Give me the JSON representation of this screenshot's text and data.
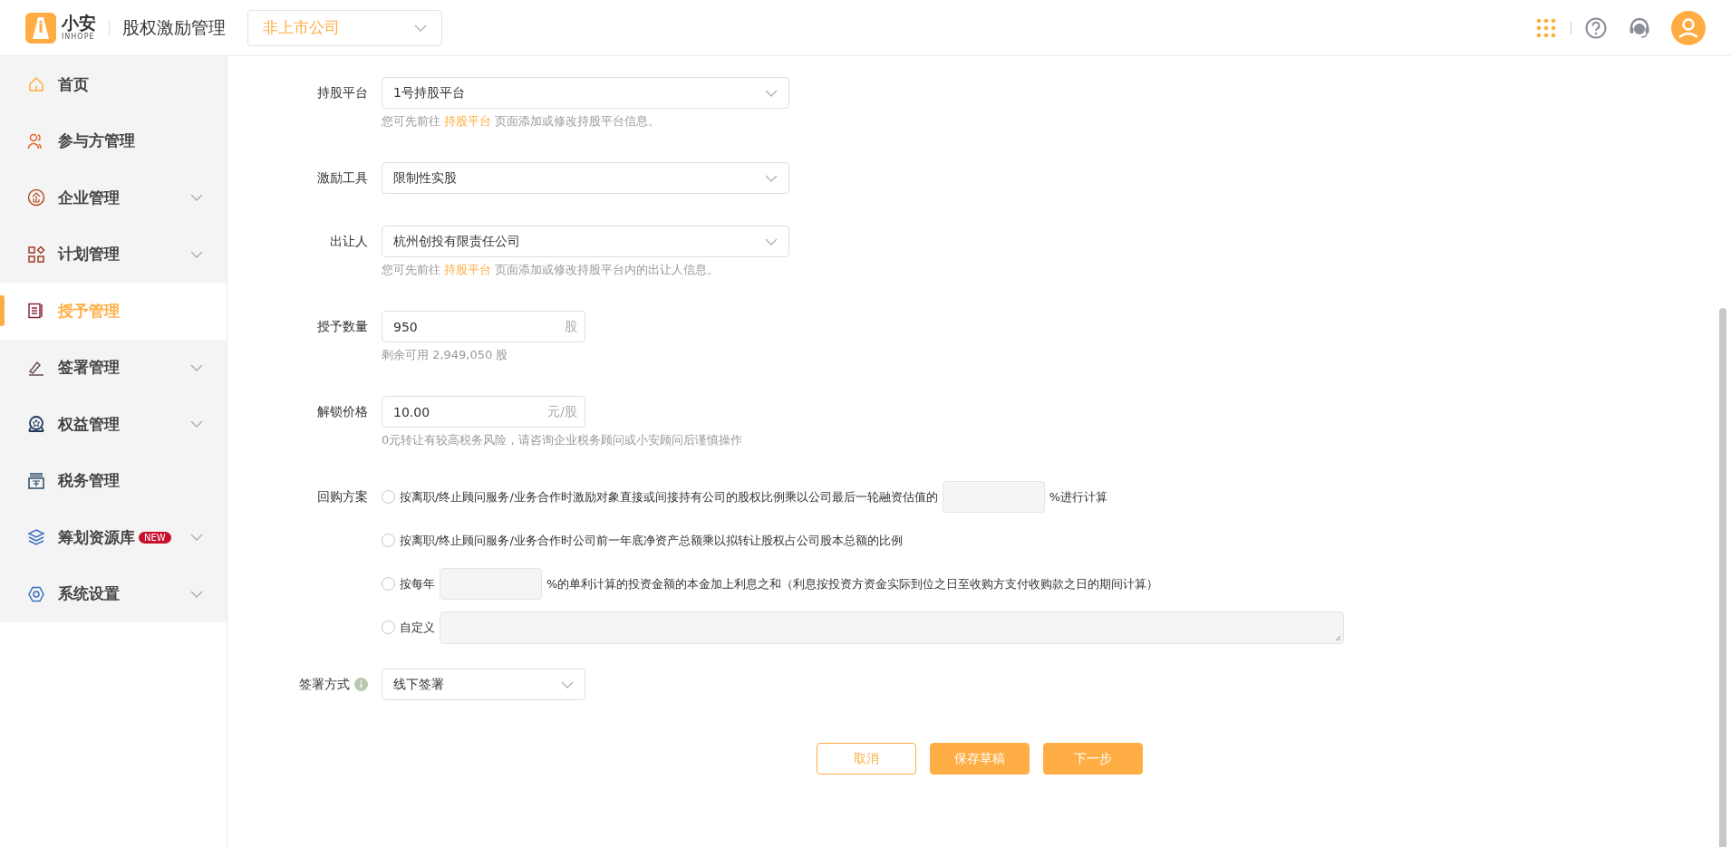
{
  "header": {
    "logo_text": "小安",
    "logo_sub": "INHOPE",
    "app_title": "股权激励管理",
    "company_select": {
      "value": "非上市公司"
    }
  },
  "sidebar": {
    "items": [
      {
        "label": "首页",
        "selected": false,
        "has_submenu": false
      },
      {
        "label": "参与方管理",
        "selected": false,
        "has_submenu": false
      },
      {
        "label": "企业管理",
        "selected": false,
        "has_submenu": true
      },
      {
        "label": "计划管理",
        "selected": false,
        "has_submenu": true
      },
      {
        "label": "授予管理",
        "selected": true,
        "has_submenu": false
      },
      {
        "label": "签署管理",
        "selected": false,
        "has_submenu": true
      },
      {
        "label": "权益管理",
        "selected": false,
        "has_submenu": true
      },
      {
        "label": "税务管理",
        "selected": false,
        "has_submenu": false
      },
      {
        "label": "筹划资源库",
        "selected": false,
        "has_submenu": true,
        "badge": "NEW"
      },
      {
        "label": "系统设置",
        "selected": false,
        "has_submenu": true
      }
    ]
  },
  "form": {
    "fields": [
      {
        "kind": "select",
        "label": "持股平台",
        "value": "1号持股平台",
        "hint": {
          "before": "您可先前往",
          "link": "持股平台",
          "after": "页面添加或修改持股平台信息。"
        }
      },
      {
        "kind": "select",
        "label": "激励工具",
        "value": "限制性实股"
      },
      {
        "kind": "select",
        "label": "出让人",
        "value": "杭州创投有限责任公司",
        "hint": {
          "before": "您可先前往",
          "link": "持股平台",
          "after": "页面添加或修改持股平台内的出让人信息。"
        }
      },
      {
        "kind": "input",
        "label": "授予数量",
        "value": "950",
        "unit": "股",
        "hint": {
          "before": "剩余可用 2,949,050 股"
        }
      },
      {
        "kind": "input",
        "label": "解锁价格",
        "value": "10.00",
        "unit": "元/股",
        "hint": {
          "before": "0元转让有较高税务风险，请咨询企业税务顾问或小安顾问后谨慎操作"
        }
      },
      {
        "kind": "radio",
        "label": "回购方案",
        "options": [
          {
            "selected": false,
            "segments": [
              {
                "kind": "text",
                "text": "按离职/终止顾问服务/业务合作时激励对象直接或间接持有公司的股权比例乘以公司最后一轮融资估值的"
              },
              {
                "kind": "field"
              },
              {
                "kind": "text",
                "text": "%进行计算"
              }
            ]
          },
          {
            "selected": false,
            "segments": [
              {
                "kind": "text",
                "text": "按离职/终止顾问服务/业务合作时公司前一年底净资产总额乘以拟转让股权占公司股本总额的比例"
              }
            ]
          },
          {
            "selected": false,
            "segments": [
              {
                "kind": "text",
                "text": "按每年"
              },
              {
                "kind": "field"
              },
              {
                "kind": "text",
                "text": "%的单利计算的投资金额的本金加上利息之和（利息按投资方资金实际到位之日至收购方支付收购款之日的期间计算）"
              }
            ]
          },
          {
            "selected": false,
            "segments": [
              {
                "kind": "text",
                "text": "自定义"
              },
              {
                "kind": "textarea"
              }
            ]
          }
        ]
      },
      {
        "kind": "select",
        "label": "签署方式",
        "info": true,
        "value": "线下签署",
        "compact": true
      }
    ]
  },
  "buttons": [
    {
      "label": "取消",
      "kind": "outline"
    },
    {
      "label": "保存草稿",
      "kind": "primary"
    },
    {
      "label": "下一步",
      "kind": "primary"
    }
  ]
}
